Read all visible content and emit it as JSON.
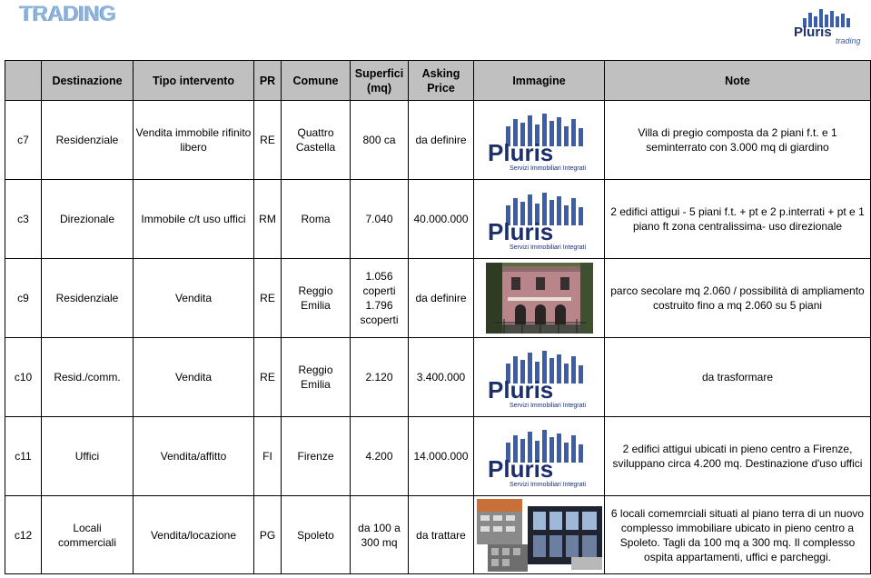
{
  "page": {
    "title": "TRADING"
  },
  "headers": {
    "destinazione": "Destinazione",
    "tipo": "Tipo intervento",
    "pr": "PR",
    "comune": "Comune",
    "superfici": "Superfici (mq)",
    "price": "Asking Price",
    "immagine": "Immagine",
    "note": "Note"
  },
  "logo": {
    "brand": "Pluris",
    "tagline": "Servizi Immobiliari Integrati",
    "top_sub": "trading"
  },
  "rows": [
    {
      "code": "c7",
      "dest": "Residenziale",
      "tipo": "Vendita immobile rifinito libero",
      "pr": "RE",
      "comune": "Quattro Castella",
      "sup": "800 ca",
      "price": "da definire",
      "image": "pluris-logo",
      "note": "Villa di pregio composta da 2 piani f.t. e 1 seminterrato con 3.000 mq di giardino"
    },
    {
      "code": "c3",
      "dest": "Direzionale",
      "tipo": "Immobile c/t uso uffici",
      "pr": "RM",
      "comune": "Roma",
      "sup": "7.040",
      "price": "40.000.000",
      "image": "pluris-logo",
      "note": "2 edifici attigui - 5 piani f.t. + pt e 2 p.interrati + pt e 1 piano ft zona centralissima- uso direzionale"
    },
    {
      "code": "c9",
      "dest": "Residenziale",
      "tipo": "Vendita",
      "pr": "RE",
      "comune": "Reggio Emilia",
      "sup": "1.056 coperti 1.796 scoperti",
      "price": "da definire",
      "image": "villa-photo",
      "note": "parco secolare mq 2.060 / possibilità di ampliamento costruito fino a mq 2.060 su 5 piani"
    },
    {
      "code": "c10",
      "dest": "Resid./comm.",
      "tipo": "Vendita",
      "pr": "RE",
      "comune": "Reggio Emilia",
      "sup": "2.120",
      "price": "3.400.000",
      "image": "pluris-logo",
      "note": "da trasformare"
    },
    {
      "code": "c11",
      "dest": "Uffici",
      "tipo": "Vendita/affitto",
      "pr": "FI",
      "comune": "Firenze",
      "sup": "4.200",
      "price": "14.000.000",
      "image": "pluris-logo",
      "note": "2 edifici attigui ubicati in pieno centro a Firenze, sviluppano circa 4.200 mq. Destinazione d'uso uffici"
    },
    {
      "code": "c12",
      "dest": "Locali commerciali",
      "tipo": "Vendita/locazione",
      "pr": "PG",
      "comune": "Spoleto",
      "sup": "da 100 a 300 mq",
      "price": "da trattare",
      "image": "building-collage",
      "note": "6 locali comemrciali situati al piano terra di un nuovo complesso immobiliare ubicato in pieno centro a Spoleto. Tagli da 100 mq a 300 mq. Il complesso ospita appartamenti, uffici e parcheggi."
    }
  ]
}
